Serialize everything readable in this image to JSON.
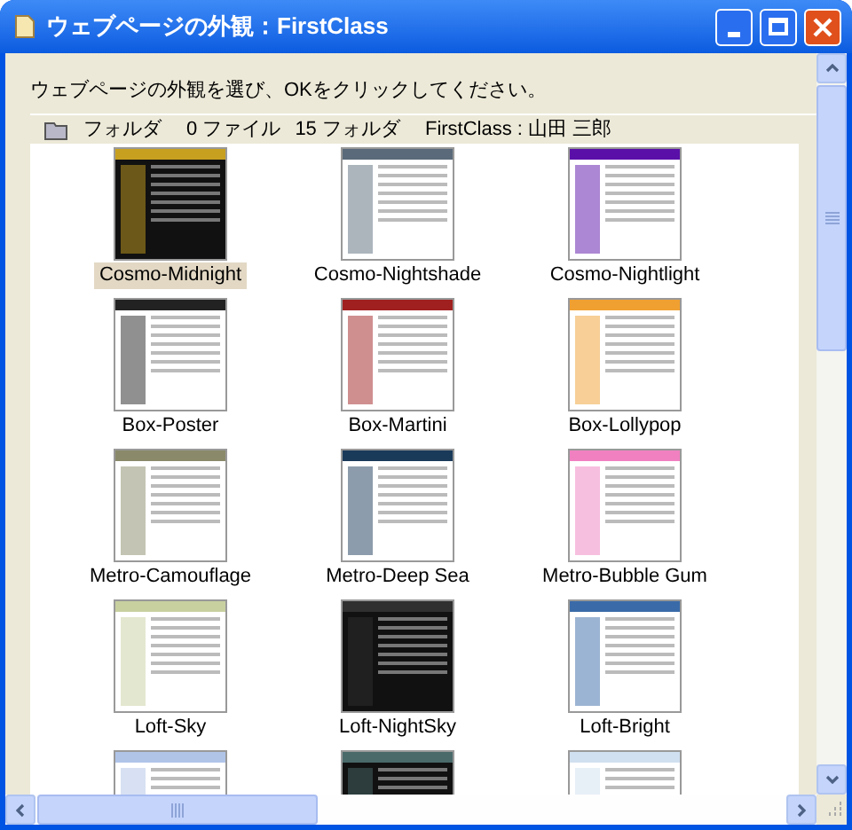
{
  "window": {
    "title": "ウェブページの外観：FirstClass"
  },
  "instruction": "ウェブページの外観を選び、OKをクリックしてください。",
  "header": {
    "type": "フォルダ",
    "files": "0 ファイル",
    "folders": "15 フォルダ",
    "location": "FirstClass : 山田 三郎"
  },
  "themes": [
    {
      "label": "Cosmo-Midnight",
      "selected": true,
      "color": "#c8a020",
      "dark": true
    },
    {
      "label": "Cosmo-Nightshade",
      "selected": false,
      "color": "#5a6a7a",
      "dark": false
    },
    {
      "label": "Cosmo-Nightlight",
      "selected": false,
      "color": "#5a10a8",
      "dark": false
    },
    {
      "label": "Box-Poster",
      "selected": false,
      "color": "#222222",
      "dark": false
    },
    {
      "label": "Box-Martini",
      "selected": false,
      "color": "#a02020",
      "dark": false
    },
    {
      "label": "Box-Lollypop",
      "selected": false,
      "color": "#f0a030",
      "dark": false
    },
    {
      "label": "Metro-Camouflage",
      "selected": false,
      "color": "#8a8a6a",
      "dark": false
    },
    {
      "label": "Metro-Deep Sea",
      "selected": false,
      "color": "#1a3a5a",
      "dark": false
    },
    {
      "label": "Metro-Bubble Gum",
      "selected": false,
      "color": "#f080c0",
      "dark": false
    },
    {
      "label": "Loft-Sky",
      "selected": false,
      "color": "#c8d0a0",
      "dark": false
    },
    {
      "label": "Loft-NightSky",
      "selected": false,
      "color": "#303030",
      "dark": true
    },
    {
      "label": "Loft-Bright",
      "selected": false,
      "color": "#3a6aa8",
      "dark": false
    },
    {
      "color": "#b0c4e8",
      "dark": false
    },
    {
      "color": "#4a6a6a",
      "dark": true
    },
    {
      "color": "#d0e0f0",
      "dark": false
    }
  ]
}
